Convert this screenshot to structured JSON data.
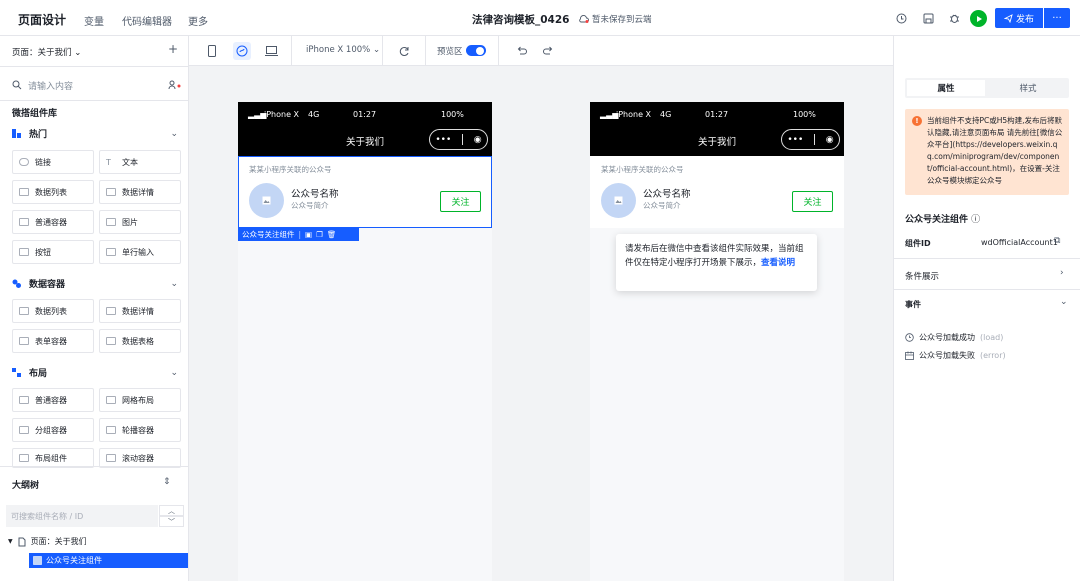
{
  "topbar": {
    "title": "页面设计",
    "nav": [
      "变量",
      "代码编辑器",
      "更多"
    ],
    "doc_title": "法律咨询模板_0426",
    "save_status": "暂未保存到云端",
    "publish_label": "发布",
    "more_label": "···"
  },
  "left": {
    "page_selector": "页面：关于我们",
    "add_label": "+",
    "search_placeholder": "请输入内容",
    "library_title": "微搭组件库",
    "sections": [
      {
        "label": "热门",
        "items": [
          "链接",
          "文本",
          "数据列表",
          "数据详情",
          "普通容器",
          "图片",
          "按钮",
          "单行输入"
        ]
      },
      {
        "label": "数据容器",
        "items": [
          "数据列表",
          "数据详情",
          "表单容器",
          "数据表格"
        ]
      },
      {
        "label": "布局",
        "items": [
          "普通容器",
          "网格布局",
          "分组容器",
          "轮播容器",
          "布局组件",
          "滚动容器"
        ]
      }
    ],
    "outline_title": "大纲树",
    "outline_search_placeholder": "可搜索组件名称 / ID",
    "tree_root": "页面：关于我们",
    "tree_child": "公众号关注组件"
  },
  "toolbar": {
    "device_label": "iPhone X 100%",
    "preview_label": "预览区"
  },
  "phone": {
    "carrier": "iPhone X",
    "network": "4G",
    "time": "01:27",
    "battery": "100%",
    "page_title": "关于我们",
    "card_top": "某某小程序关联的公众号",
    "account_name": "公众号名称",
    "account_desc": "公众号简介",
    "follow_label": "关注"
  },
  "selection_label": "公众号关注组件",
  "tooltip": {
    "text": "请发布后在微信中查看该组件实际效果，当前组件仅在特定小程序打开场景下展示，",
    "link": "查看说明"
  },
  "right": {
    "tabs": [
      "属性",
      "样式"
    ],
    "warning": "当前组件不支持PC或H5构建,发布后将默认隐藏,请注意页面布局 请先前往[微信公众平台](https://developers.weixin.qq.com/miniprogram/dev/component/official-account.html)，在设置-关注公众号模块绑定公众号",
    "component_title": "公众号关注组件",
    "id_label": "组件ID",
    "id_value": "wdOfficialAccount1",
    "condition_label": "条件展示",
    "events_label": "事件",
    "events": [
      {
        "name": "公众号加载成功",
        "code": "(load)"
      },
      {
        "name": "公众号加载失败",
        "code": "(error)"
      }
    ]
  },
  "colors": {
    "accent": "#165dff",
    "success": "#00b42a",
    "warning": "#f77234"
  }
}
